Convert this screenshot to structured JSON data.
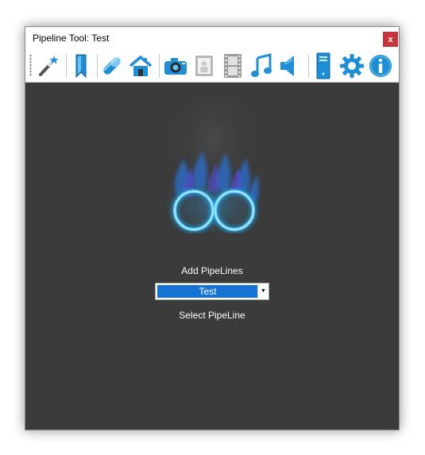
{
  "window": {
    "title": "Pipeline Tool: Test",
    "close_label": "x"
  },
  "toolbar": {
    "tools": [
      {
        "icon": "magic-wand-icon"
      },
      {
        "icon": "bookmark-icon"
      },
      {
        "icon": "pill-icon"
      },
      {
        "icon": "home-icon"
      },
      {
        "icon": "camera-icon"
      },
      {
        "icon": "picture-frame-icon"
      },
      {
        "icon": "film-strip-icon"
      },
      {
        "icon": "music-note-icon"
      },
      {
        "icon": "speaker-icon"
      },
      {
        "icon": "computer-tower-icon"
      },
      {
        "icon": "gear-icon"
      },
      {
        "icon": "info-icon"
      }
    ]
  },
  "main": {
    "logo_icon": "blue-flame-infinity-icon",
    "add_pipelines_label": "Add PipeLines",
    "pipeline_select": {
      "value": "Test"
    },
    "select_pipeline_label": "Select PipeLine"
  },
  "colors": {
    "background": "#3b3b3b",
    "accent_blue": "#1673d4",
    "close_red": "#c8353b",
    "icon_blue": "#1e8fd6"
  }
}
